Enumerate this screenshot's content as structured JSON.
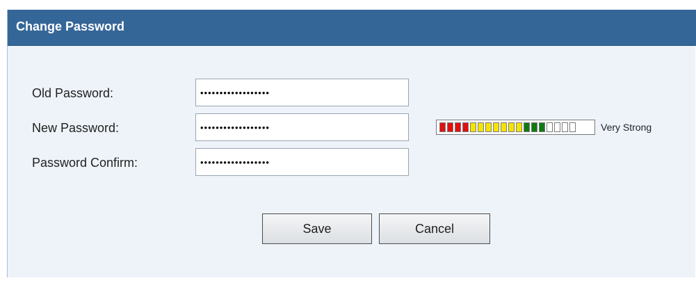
{
  "header": {
    "title": "Change Password",
    "bg_color": "#356698"
  },
  "form": {
    "old_password": {
      "label": "Old Password:",
      "value": "••••••••••••••••••"
    },
    "new_password": {
      "label": "New Password:",
      "value": "••••••••••••••••••"
    },
    "password_confirm": {
      "label": "Password Confirm:",
      "value": "••••••••••••••••••"
    }
  },
  "strength_meter": {
    "label": "Very Strong",
    "level_segments": 14,
    "total_segments": 18,
    "segment_colors": [
      "#e01010",
      "#e01010",
      "#e01010",
      "#e01010",
      "#f4e404",
      "#f4e404",
      "#f4e404",
      "#f4e404",
      "#f4e404",
      "#f4e404",
      "#f4e404",
      "#107a10",
      "#107a10",
      "#107a10",
      "#ffffff",
      "#ffffff",
      "#ffffff",
      "#ffffff"
    ]
  },
  "buttons": {
    "save_label": "Save",
    "cancel_label": "Cancel"
  }
}
